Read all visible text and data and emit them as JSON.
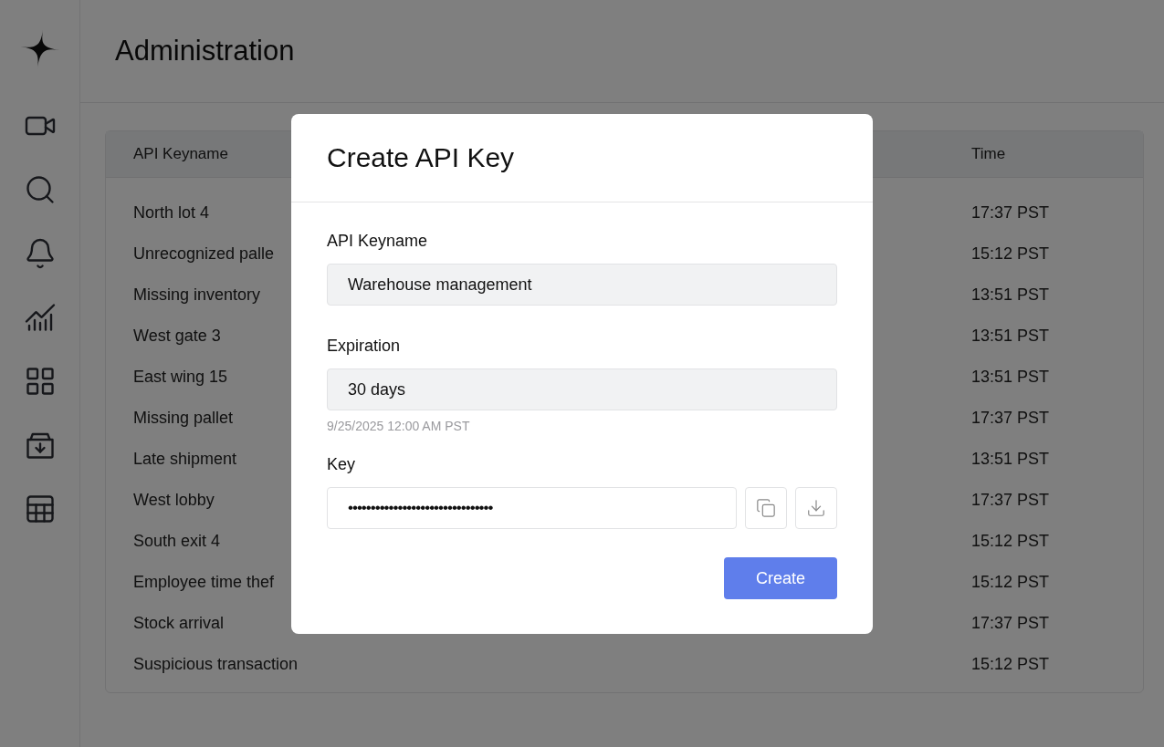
{
  "page": {
    "title": "Administration"
  },
  "sidebar": {
    "items": [
      {
        "selected": false
      },
      {
        "selected": false
      },
      {
        "selected": false
      },
      {
        "selected": false
      },
      {
        "selected": false
      },
      {
        "selected": false
      },
      {
        "selected": false
      }
    ]
  },
  "table": {
    "columns": [
      "API Keyname",
      "Time"
    ],
    "rows": [
      {
        "name": "North lot 4",
        "time": "17:37 PST"
      },
      {
        "name": "Unrecognized palle",
        "time": "15:12 PST"
      },
      {
        "name": "Missing inventory",
        "time": "13:51 PST"
      },
      {
        "name": "West gate 3",
        "time": "13:51 PST"
      },
      {
        "name": "East wing 15",
        "time": "13:51 PST"
      },
      {
        "name": "Missing pallet",
        "time": "17:37 PST"
      },
      {
        "name": "Late shipment",
        "time": "13:51 PST"
      },
      {
        "name": "West lobby",
        "time": "17:37 PST"
      },
      {
        "name": "South exit 4",
        "time": "15:12 PST"
      },
      {
        "name": "Employee time thef",
        "time": "15:12 PST"
      },
      {
        "name": "Stock arrival",
        "time": "17:37 PST"
      },
      {
        "name": "Suspicious transaction",
        "time": "15:12 PST"
      }
    ]
  },
  "dialog": {
    "title": "Create API Key",
    "keyname": {
      "label": "API Keyname",
      "value": "Warehouse management"
    },
    "expiration": {
      "label": "Expiration",
      "value": "30 days",
      "hint": "9/25/2025 12:00 AM PST"
    },
    "key": {
      "label": "Key",
      "value": "••••••••••••••••••••••••••••••••"
    },
    "button": "Create"
  }
}
